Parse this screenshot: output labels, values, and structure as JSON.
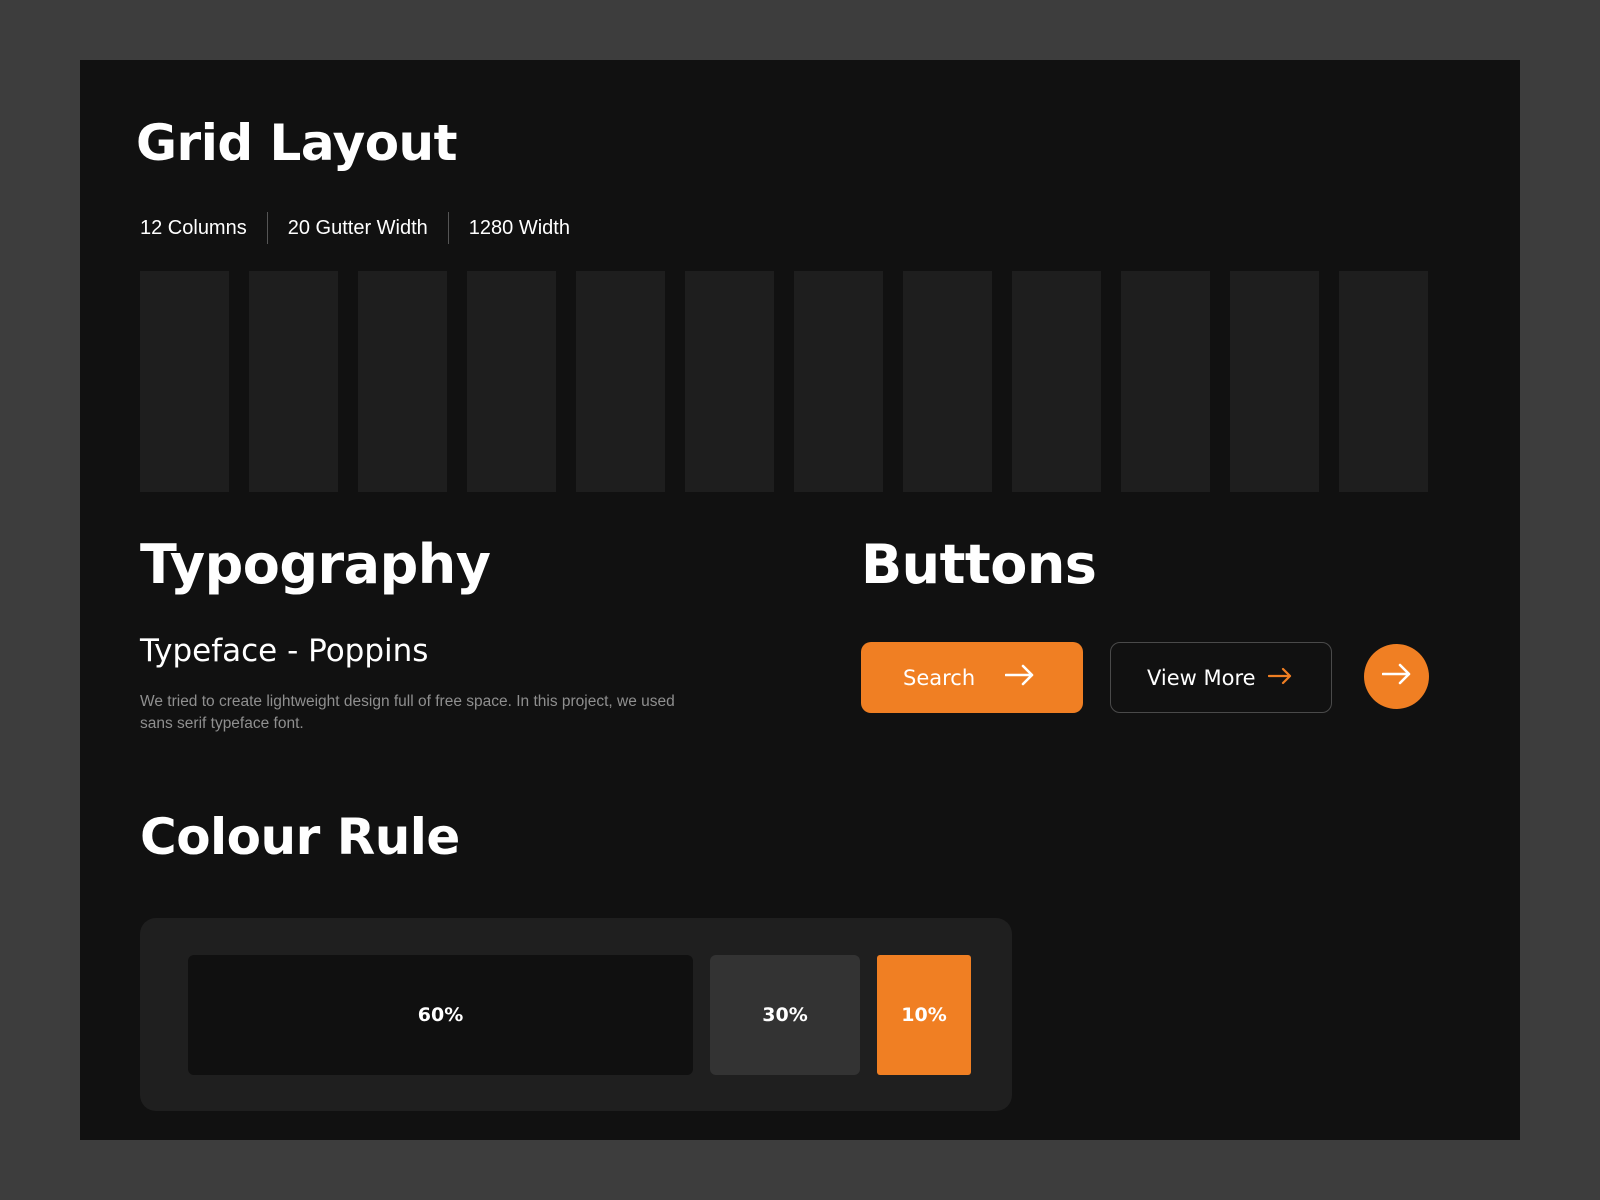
{
  "grid": {
    "title": "Grid Layout",
    "specs": [
      "12 Columns",
      "20 Gutter Width",
      "1280 Width"
    ],
    "column_count": 12
  },
  "typography": {
    "title": "Typography",
    "typeface": "Typeface - Poppins",
    "description": "We tried to create lightweight design full of free space. In this project, we used sans serif typeface font."
  },
  "buttons": {
    "title": "Buttons",
    "search_label": "Search",
    "view_more_label": "View More",
    "arrow_icon": "arrow-right-icon"
  },
  "colour_rule": {
    "title": "Colour Rule",
    "swatches": [
      {
        "label": "60%",
        "color": "#101010"
      },
      {
        "label": "30%",
        "color": "#333333"
      },
      {
        "label": "10%",
        "color": "#f07f23"
      }
    ]
  },
  "colors": {
    "background": "#111111",
    "surface": "#1e1e1e",
    "accent": "#f07f23",
    "text": "#ffffff",
    "muted_text": "#8f8f8f"
  }
}
